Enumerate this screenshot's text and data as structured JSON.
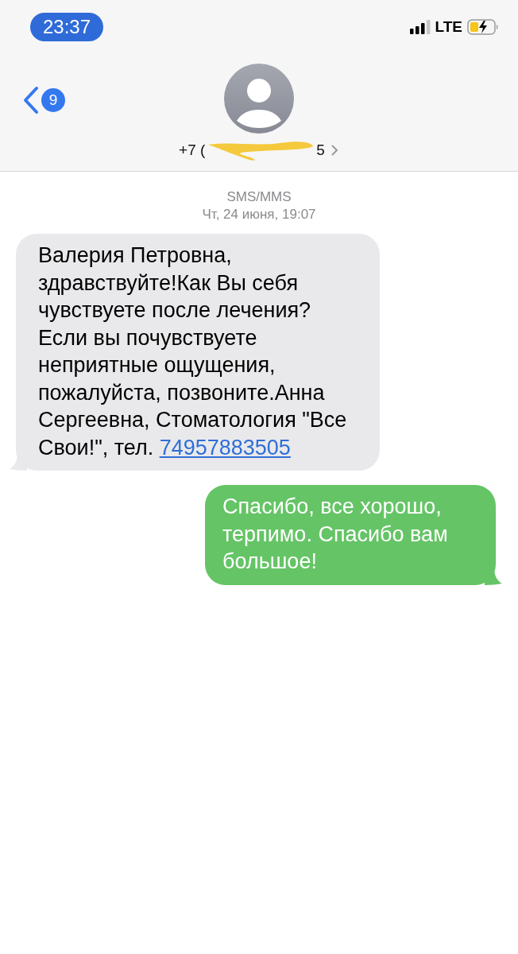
{
  "status_bar": {
    "time": "23:37",
    "network": "LTE"
  },
  "header": {
    "back_badge": "9",
    "contact_prefix": "+7 (",
    "contact_suffix": "5"
  },
  "thread_meta": {
    "service": "SMS/MMS",
    "date": "Чт, 24 июня, 19:07"
  },
  "messages": [
    {
      "kind": "incoming",
      "text": "Валерия Петровна, здравствуйте!Как Вы себя чувствуете после лечения? Если вы почувствуете неприятные ощущения, пожалуйста, позвоните.Анна Сергеевна, Стоматология \"Все Свои!\", тел.",
      "link": "74957883505"
    },
    {
      "kind": "outgoing",
      "text": "Спасибо, все хорошо, терпимо. Спасибо вам большое!"
    }
  ]
}
